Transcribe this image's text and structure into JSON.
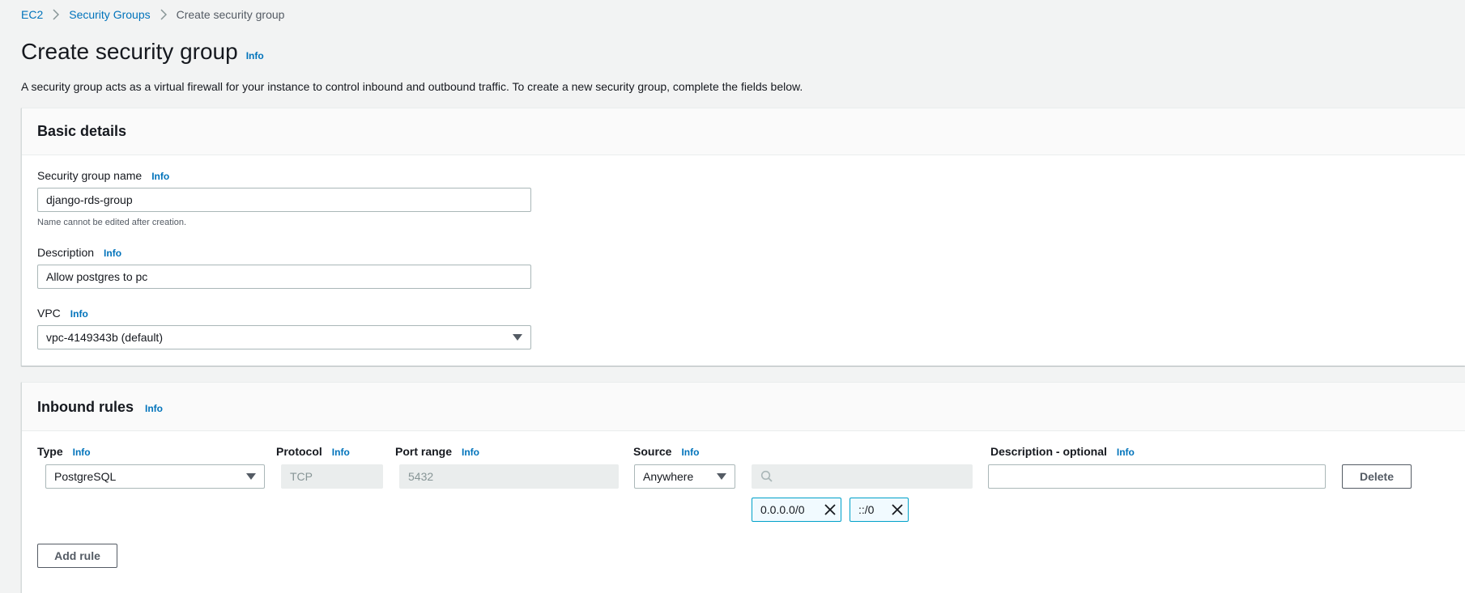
{
  "breadcrumb": {
    "items": [
      "EC2",
      "Security Groups"
    ],
    "current": "Create security group"
  },
  "page": {
    "title": "Create security group",
    "info": "Info",
    "description": "A security group acts as a virtual firewall for your instance to control inbound and outbound traffic. To create a new security group, complete the fields below."
  },
  "basic_details": {
    "title": "Basic details",
    "name_label": "Security group name",
    "name_info": "Info",
    "name_value": "django-rds-group",
    "name_hint": "Name cannot be edited after creation.",
    "description_label": "Description",
    "description_info": "Info",
    "description_value": "Allow postgres to pc",
    "vpc_label": "VPC",
    "vpc_info": "Info",
    "vpc_value": "vpc-4149343b (default)"
  },
  "inbound_rules": {
    "title": "Inbound rules",
    "info": "Info",
    "columns": {
      "type": "Type",
      "protocol": "Protocol",
      "port_range": "Port range",
      "source": "Source",
      "description": "Description - optional",
      "info": "Info"
    },
    "rule": {
      "type": "PostgreSQL",
      "protocol": "TCP",
      "port_range": "5432",
      "source": "Anywhere",
      "cidr_search_placeholder": "",
      "tokens": [
        "0.0.0.0/0",
        "::/0"
      ],
      "description": ""
    },
    "delete_label": "Delete",
    "add_rule_label": "Add rule"
  }
}
